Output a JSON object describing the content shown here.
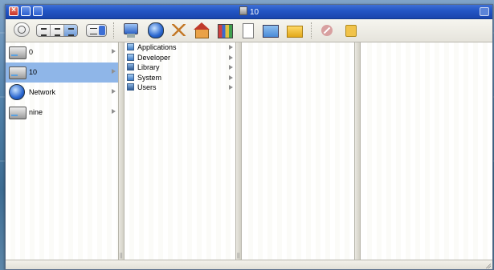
{
  "window": {
    "title": "10"
  },
  "toolbar": {
    "buttons": [
      {
        "name": "back-button",
        "icon": "back-arrow-icon"
      },
      {
        "name": "view-icons",
        "icon": "icon-view-icon"
      },
      {
        "name": "view-list",
        "icon": "list-view-icon"
      },
      {
        "name": "view-columns",
        "icon": "column-view-icon"
      },
      {
        "name": "action-menu",
        "icon": "action-menu-icon"
      },
      {
        "name": "computer",
        "icon": "computer-icon"
      },
      {
        "name": "network",
        "icon": "network-icon"
      },
      {
        "name": "applications",
        "icon": "applications-icon"
      },
      {
        "name": "home",
        "icon": "home-icon"
      },
      {
        "name": "library",
        "icon": "library-icon"
      },
      {
        "name": "document",
        "icon": "document-icon"
      },
      {
        "name": "pictures",
        "icon": "pictures-icon"
      },
      {
        "name": "new-folder",
        "icon": "new-folder-icon"
      },
      {
        "name": "stop",
        "icon": "stop-icon"
      },
      {
        "name": "info",
        "icon": "info-icon"
      }
    ]
  },
  "columns": {
    "volumes": [
      {
        "label": "0",
        "icon": "hard-disk-icon",
        "selected": false
      },
      {
        "label": "10",
        "icon": "hard-disk-icon",
        "selected": true
      },
      {
        "label": "Network",
        "icon": "globe-icon",
        "selected": false
      },
      {
        "label": "nine",
        "icon": "hard-disk-icon",
        "selected": false
      }
    ],
    "folders": [
      {
        "label": "Applications"
      },
      {
        "label": "Developer"
      },
      {
        "label": "Library"
      },
      {
        "label": "System"
      },
      {
        "label": "Users"
      }
    ]
  },
  "colors": {
    "titlebar": "#2457c6",
    "selection": "#8fb6e8",
    "window_bg": "#f0efe8"
  }
}
